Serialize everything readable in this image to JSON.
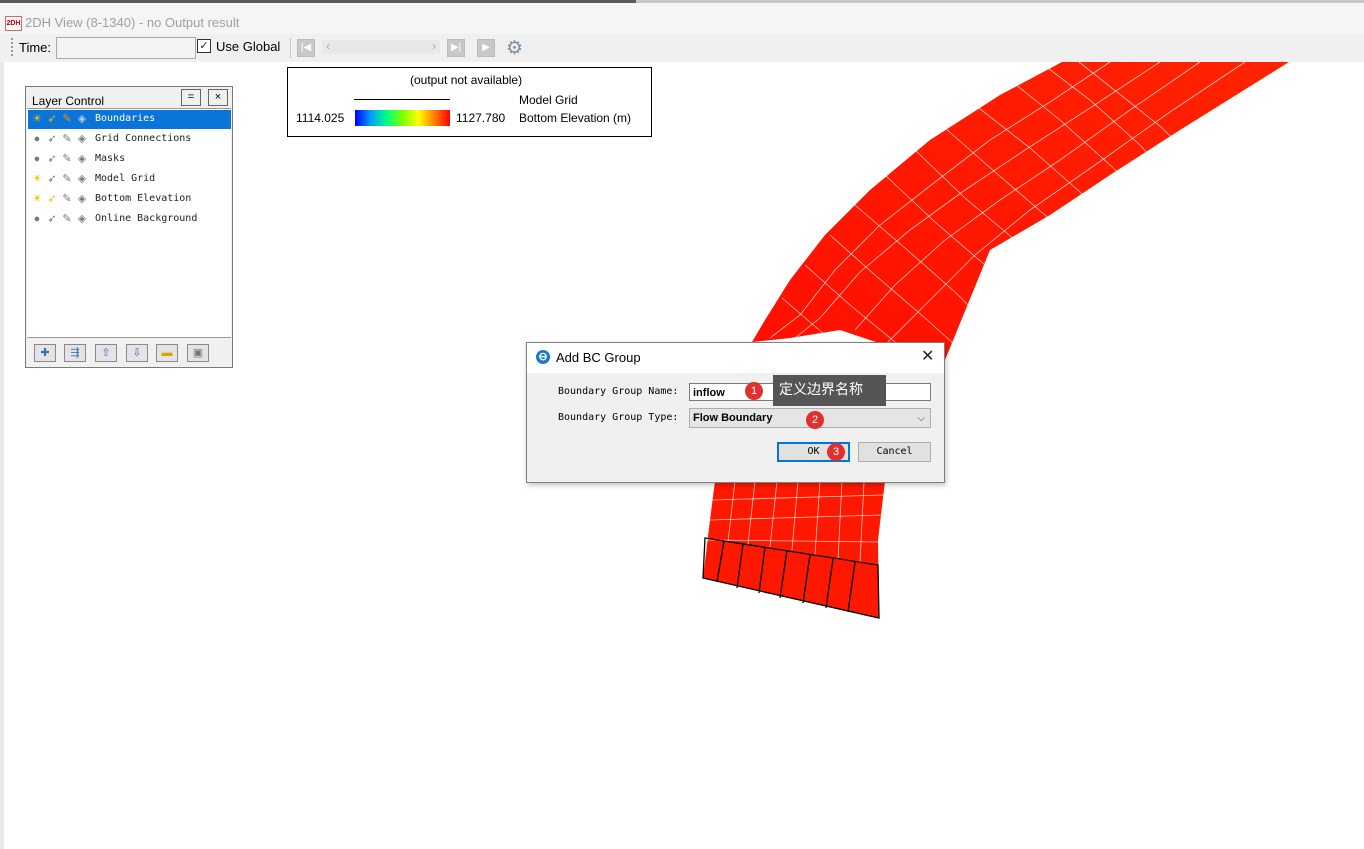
{
  "window": {
    "title": "2DH View (8-1340) - no Output result",
    "icon_text": "2DH"
  },
  "toolbar": {
    "time_label": "Time:",
    "time_value": "",
    "use_global_label": "Use Global",
    "use_global_checked": true,
    "icons": [
      "first-frame-icon",
      "prev-icon",
      "next-icon",
      "last-frame-icon",
      "play-icon",
      "settings-gear-icon"
    ]
  },
  "layer_control": {
    "title": "Layer Control",
    "dock_label": "=",
    "close_label": "×",
    "layers": [
      {
        "label": "Boundaries",
        "selected": true,
        "visible": true
      },
      {
        "label": "Grid Connections",
        "selected": false,
        "visible": false
      },
      {
        "label": "Masks",
        "selected": false,
        "visible": false
      },
      {
        "label": "Model Grid",
        "selected": false,
        "visible": true
      },
      {
        "label": "Bottom Elevation",
        "selected": false,
        "visible": true
      },
      {
        "label": "Online Background",
        "selected": false,
        "visible": false
      }
    ],
    "bottom_buttons": [
      "add-layer-icon",
      "import-layer-icon",
      "move-up-icon",
      "move-down-icon",
      "open-folder-icon",
      "save-icon"
    ]
  },
  "legend": {
    "status": "(output not available)",
    "grid_label": "Model Grid",
    "min_value": "1114.025",
    "max_value": "1127.780",
    "variable_label": "Bottom Elevation (m)",
    "colormap": [
      "#0000ff",
      "#00a0ff",
      "#00ff80",
      "#80ff00",
      "#ffff00",
      "#ff8000",
      "#ff0000"
    ]
  },
  "dialog": {
    "title": "Add BC Group",
    "name_label": "Boundary Group Name:",
    "name_value": "inflow",
    "type_label": "Boundary Group Type:",
    "type_value": "Flow Boundary",
    "ok_label": "OK",
    "cancel_label": "Cancel",
    "close_label": "✕"
  },
  "annotations": {
    "markers": [
      "1",
      "2",
      "3"
    ],
    "tooltip": "定义边界名称",
    "marker_color": "#e0302f"
  },
  "colors": {
    "mesh_fill": "#ff1a00",
    "selection": "#0a74d8"
  }
}
